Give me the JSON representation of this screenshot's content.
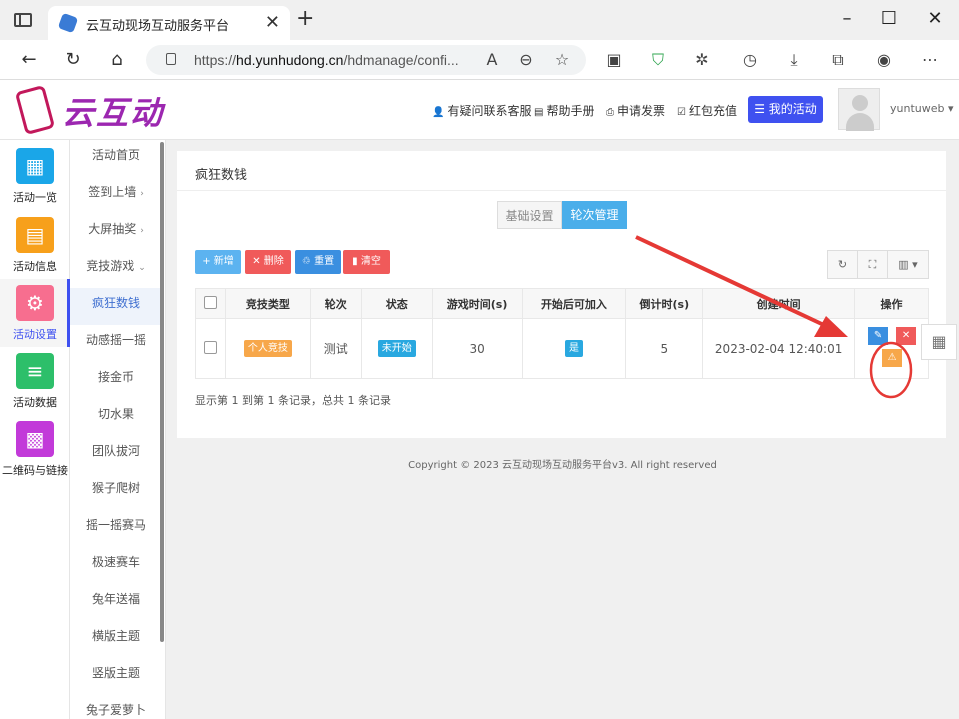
{
  "browser": {
    "tab_title": "云互动现场互动服务平台",
    "url_prefix": "https://",
    "url_domain": "hd.yunhudong.cn",
    "url_path": "/hdmanage/confi..."
  },
  "header": {
    "logo_text": "云互动",
    "links": [
      "有疑问联系客服",
      "帮助手册",
      "申请发票",
      "红包充值"
    ],
    "my_activity": "我的活动",
    "username": "yuntuweb"
  },
  "iconnav": [
    {
      "label": "活动一览",
      "icon": "grid-icon",
      "color": "#1aa6e8"
    },
    {
      "label": "活动信息",
      "icon": "document-icon",
      "color": "#f7a01b"
    },
    {
      "label": "活动设置",
      "icon": "gear-icon",
      "color": "#f76e8f"
    },
    {
      "label": "活动数据",
      "icon": "database-icon",
      "color": "#2dbf6a"
    },
    {
      "label": "二维码与链接",
      "icon": "qrcode-icon",
      "color": "#c23ad9"
    }
  ],
  "submenu": [
    {
      "label": "活动首页"
    },
    {
      "label": "签到上墙",
      "arrow": "›"
    },
    {
      "label": "大屏抽奖",
      "arrow": "›"
    },
    {
      "label": "竞技游戏",
      "arrow": "⌄"
    },
    {
      "label": "疯狂数钱"
    },
    {
      "label": "动感摇一摇"
    },
    {
      "label": "接金币"
    },
    {
      "label": "切水果"
    },
    {
      "label": "团队拔河"
    },
    {
      "label": "猴子爬树"
    },
    {
      "label": "摇一摇赛马"
    },
    {
      "label": "极速赛车"
    },
    {
      "label": "兔年送福"
    },
    {
      "label": "横版主题"
    },
    {
      "label": "竖版主题"
    },
    {
      "label": "兔子爱萝卜"
    }
  ],
  "main": {
    "title": "疯狂数钱",
    "tabs": [
      "基础设置",
      "轮次管理"
    ],
    "toolbar": {
      "add": "+ 新增",
      "delete": "✕ 删除",
      "reset": "重置",
      "clear": "清空"
    },
    "table": {
      "headers": [
        "竞技类型",
        "轮次",
        "状态",
        "游戏时间(s)",
        "开始后可加入",
        "倒计时(s)",
        "创建时间",
        "操作"
      ],
      "rows": [
        {
          "type": "个人竞技",
          "round": "测试",
          "status": "未开始",
          "game_time": "30",
          "join": "是",
          "countdown": "5",
          "created": "2023-02-04 12:40:01"
        }
      ]
    },
    "page_info": "显示第 1 到第 1 条记录，总共 1 条记录"
  },
  "footer": {
    "copyright": "Copyright © 2023 云互动现场互动服务平台v3. All right reserved"
  },
  "colors": {
    "accent": "#3f51f0",
    "active_tab": "#4aaeea",
    "annotation": "#e53935"
  }
}
